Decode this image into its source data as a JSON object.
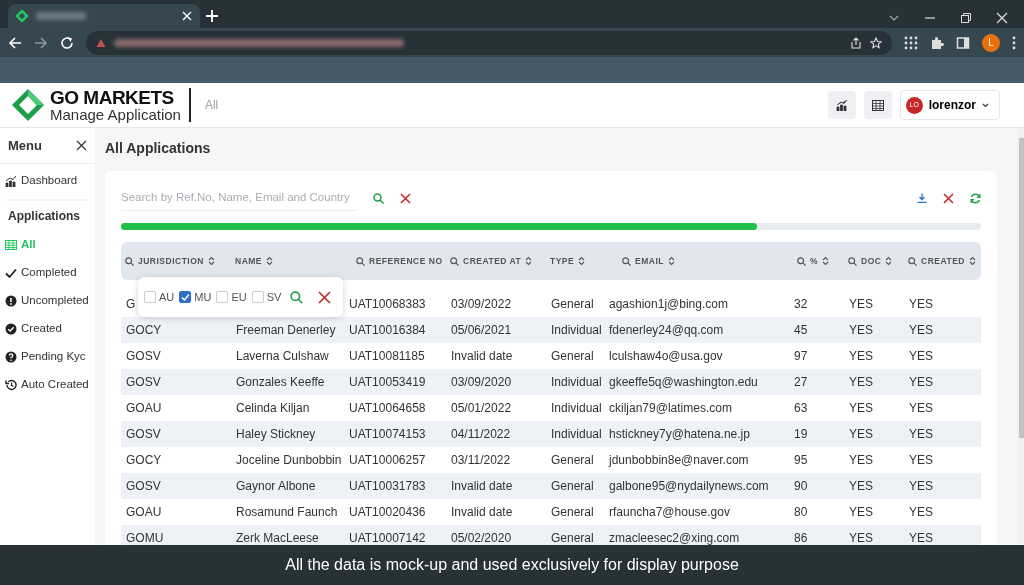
{
  "browser": {
    "profile_initial": "L"
  },
  "header": {
    "logo_title": "GO MARKETS",
    "logo_subtitle": "Manage Application",
    "breadcrumb": "All",
    "user": {
      "initials": "LO",
      "name": "lorenzor"
    }
  },
  "sidebar": {
    "title": "Menu",
    "top_items": [
      {
        "label": "Dashboard",
        "selected": false
      }
    ],
    "section": "Applications",
    "items": [
      {
        "label": "All",
        "selected": true
      },
      {
        "label": "Completed",
        "selected": false
      },
      {
        "label": "Uncompleted",
        "selected": false
      },
      {
        "label": "Created",
        "selected": false
      },
      {
        "label": "Pending Kyc",
        "selected": false
      },
      {
        "label": "Auto Created",
        "selected": false
      }
    ]
  },
  "main": {
    "title": "All Applications",
    "search": {
      "placeholder": "Search by Ref.No, Name, Email and Country"
    },
    "progress": {
      "level": 0.74
    }
  },
  "table": {
    "columns": [
      {
        "label": "JURISDICTION",
        "sortable": true
      },
      {
        "label": "NAME",
        "sortable": true,
        "filter": false
      },
      {
        "label": "REFERENCE NO",
        "sortable": false
      },
      {
        "label": "CREATED AT",
        "sortable": true
      },
      {
        "label": "TYPE",
        "sortable": true,
        "filter": false
      },
      {
        "label": "EMAIL",
        "sortable": true
      },
      {
        "label": "%",
        "sortable": true
      },
      {
        "label": "DOC",
        "sortable": true
      },
      {
        "label": "CREATED",
        "sortable": true
      }
    ],
    "filter_popup": {
      "options": [
        {
          "label": "AU",
          "checked": false
        },
        {
          "label": "MU",
          "checked": true
        },
        {
          "label": "EU",
          "checked": false
        },
        {
          "label": "SV",
          "checked": false
        }
      ]
    },
    "rows": [
      [
        "G",
        "",
        "UAT10068383",
        "03/09/2022",
        "General",
        "agashion1j@bing.com",
        "32",
        "YES",
        "YES"
      ],
      [
        "GOCY",
        "Freeman Denerley",
        "UAT10016384",
        "05/06/2021",
        "Individual",
        "fdenerley24@qq.com",
        "45",
        "YES",
        "YES"
      ],
      [
        "GOSV",
        "Laverna Culshaw",
        "UAT10081185",
        "Invalid date",
        "General",
        "lculshaw4o@usa.gov",
        "97",
        "YES",
        "YES"
      ],
      [
        "GOSV",
        "Gonzales Keeffe",
        "UAT10053419",
        "03/09/2020",
        "Individual",
        "gkeeffe5q@washington.edu",
        "27",
        "YES",
        "YES"
      ],
      [
        "GOAU",
        "Celinda Kiljan",
        "UAT10064658",
        "05/01/2022",
        "Individual",
        "ckiljan79@latimes.com",
        "63",
        "YES",
        "YES"
      ],
      [
        "GOSV",
        "Haley Stickney",
        "UAT10074153",
        "04/11/2022",
        "Individual",
        "hstickney7y@hatena.ne.jp",
        "19",
        "YES",
        "YES"
      ],
      [
        "GOCY",
        "Joceline Dunbobbin",
        "UAT10006257",
        "03/11/2022",
        "General",
        "jdunbobbin8e@naver.com",
        "95",
        "YES",
        "YES"
      ],
      [
        "GOSV",
        "Gaynor Albone",
        "UAT10031783",
        "Invalid date",
        "General",
        "galbone95@nydailynews.com",
        "90",
        "YES",
        "YES"
      ],
      [
        "GOAU",
        "Rosamund Faunch",
        "UAT10020436",
        "Invalid date",
        "General",
        "rfauncha7@house.gov",
        "80",
        "YES",
        "YES"
      ],
      [
        "GOMU",
        "Zerk MacLeese",
        "UAT10007142",
        "05/02/2020",
        "General",
        "zmacleesec2@xing.com",
        "86",
        "YES",
        "YES"
      ]
    ]
  },
  "caption": "All the data is mock-up and used exclusively for display purpose"
}
